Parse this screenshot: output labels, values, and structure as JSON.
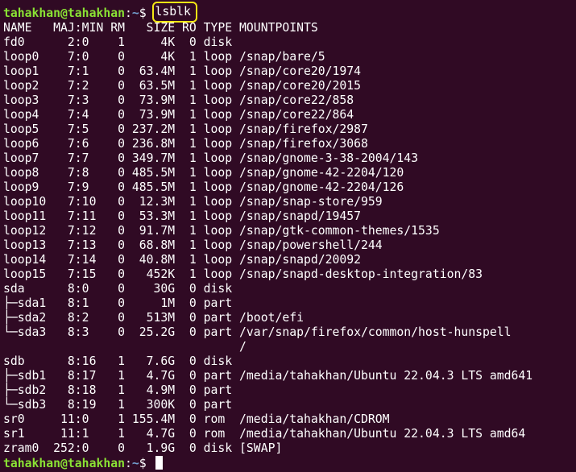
{
  "prompt": {
    "user": "tahakhan@tahakhan",
    "path": "~",
    "symbol": "$"
  },
  "command": "lsblk",
  "colors": {
    "background": "#300a24",
    "prompt_user": "#8ae234",
    "prompt_path": "#729fcf",
    "highlight": "#f5e814"
  },
  "output_lines": [
    "NAME   MAJ:MIN RM   SIZE RO TYPE MOUNTPOINTS",
    "fd0      2:0    1     4K  0 disk ",
    "loop0    7:0    0     4K  1 loop /snap/bare/5",
    "loop1    7:1    0  63.4M  1 loop /snap/core20/1974",
    "loop2    7:2    0  63.5M  1 loop /snap/core20/2015",
    "loop3    7:3    0  73.9M  1 loop /snap/core22/858",
    "loop4    7:4    0  73.9M  1 loop /snap/core22/864",
    "loop5    7:5    0 237.2M  1 loop /snap/firefox/2987",
    "loop6    7:6    0 236.8M  1 loop /snap/firefox/3068",
    "loop7    7:7    0 349.7M  1 loop /snap/gnome-3-38-2004/143",
    "loop8    7:8    0 485.5M  1 loop /snap/gnome-42-2204/120",
    "loop9    7:9    0 485.5M  1 loop /snap/gnome-42-2204/126",
    "loop10   7:10   0  12.3M  1 loop /snap/snap-store/959",
    "loop11   7:11   0  53.3M  1 loop /snap/snapd/19457",
    "loop12   7:12   0  91.7M  1 loop /snap/gtk-common-themes/1535",
    "loop13   7:13   0  68.8M  1 loop /snap/powershell/244",
    "loop14   7:14   0  40.8M  1 loop /snap/snapd/20092",
    "loop15   7:15   0   452K  1 loop /snap/snapd-desktop-integration/83",
    "sda      8:0    0    30G  0 disk ",
    "├─sda1   8:1    0     1M  0 part ",
    "├─sda2   8:2    0   513M  0 part /boot/efi",
    "└─sda3   8:3    0  25.2G  0 part /var/snap/firefox/common/host-hunspell",
    "                                 /",
    "sdb      8:16   1   7.6G  0 disk ",
    "├─sdb1   8:17   1   4.7G  0 part /media/tahakhan/Ubuntu 22.04.3 LTS amd641",
    "├─sdb2   8:18   1   4.9M  0 part ",
    "└─sdb3   8:19   1   300K  0 part ",
    "sr0     11:0    1 155.4M  0 rom  /media/tahakhan/CDROM",
    "sr1     11:1    1   4.7G  0 rom  /media/tahakhan/Ubuntu 22.04.3 LTS amd64",
    "zram0  252:0    0   1.9G  0 disk [SWAP]"
  ]
}
